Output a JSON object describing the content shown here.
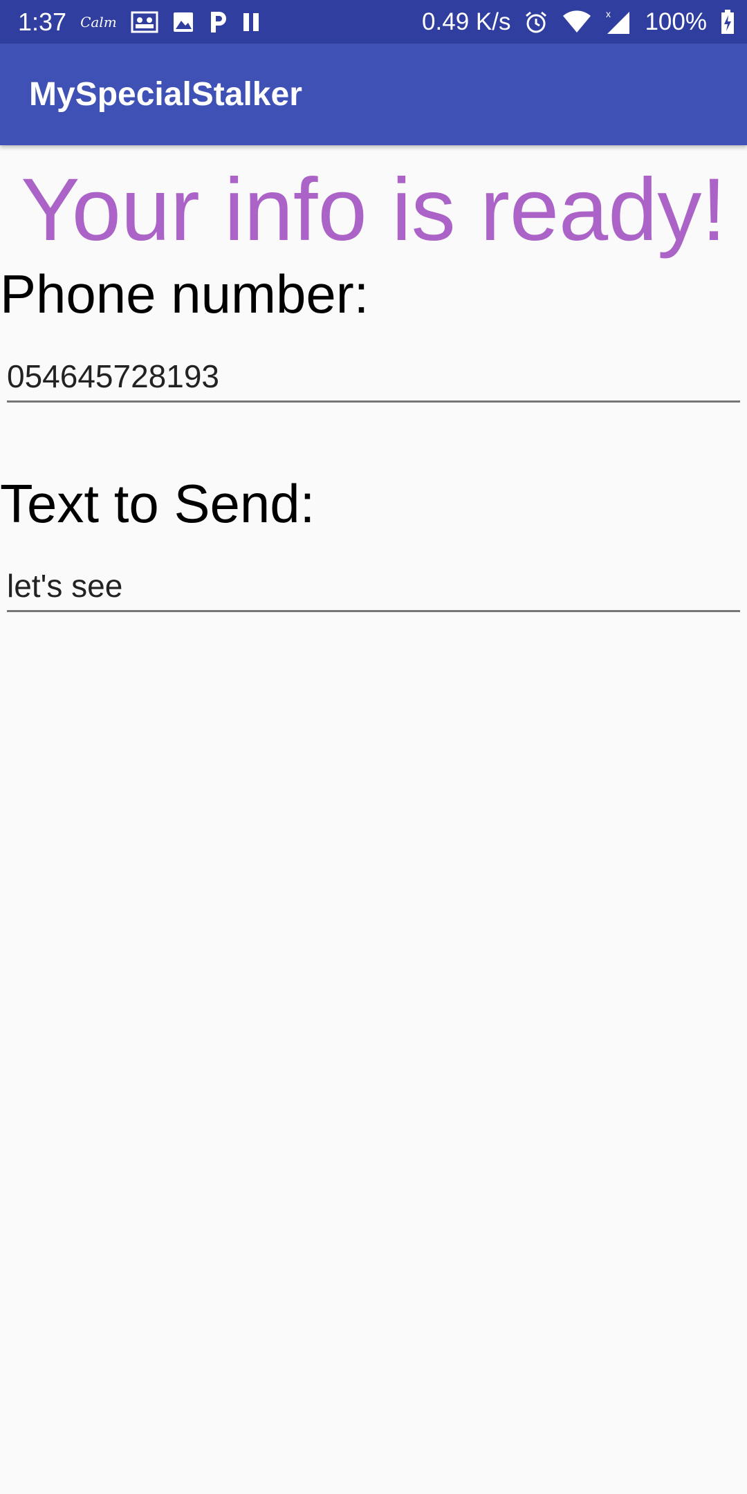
{
  "status_bar": {
    "time": "1:37",
    "calm_label": "Calm",
    "network_rate": "0.49 K/s",
    "battery": "100%",
    "icons": [
      "calm-icon",
      "contacts-card-icon",
      "image-icon",
      "parking-icon",
      "pause-icon",
      "alarm-icon",
      "wifi-icon",
      "signal-icon",
      "battery-charging-icon"
    ]
  },
  "app_bar": {
    "title": "MySpecialStalker",
    "color": "#3f51b5",
    "status_color": "#303f9f"
  },
  "main": {
    "headline": "Your info is ready!",
    "headline_color": "#ab63c8",
    "phone": {
      "label": "Phone number:",
      "value": "054645728193"
    },
    "message": {
      "label": "Text to Send:",
      "value": "let's see"
    }
  }
}
